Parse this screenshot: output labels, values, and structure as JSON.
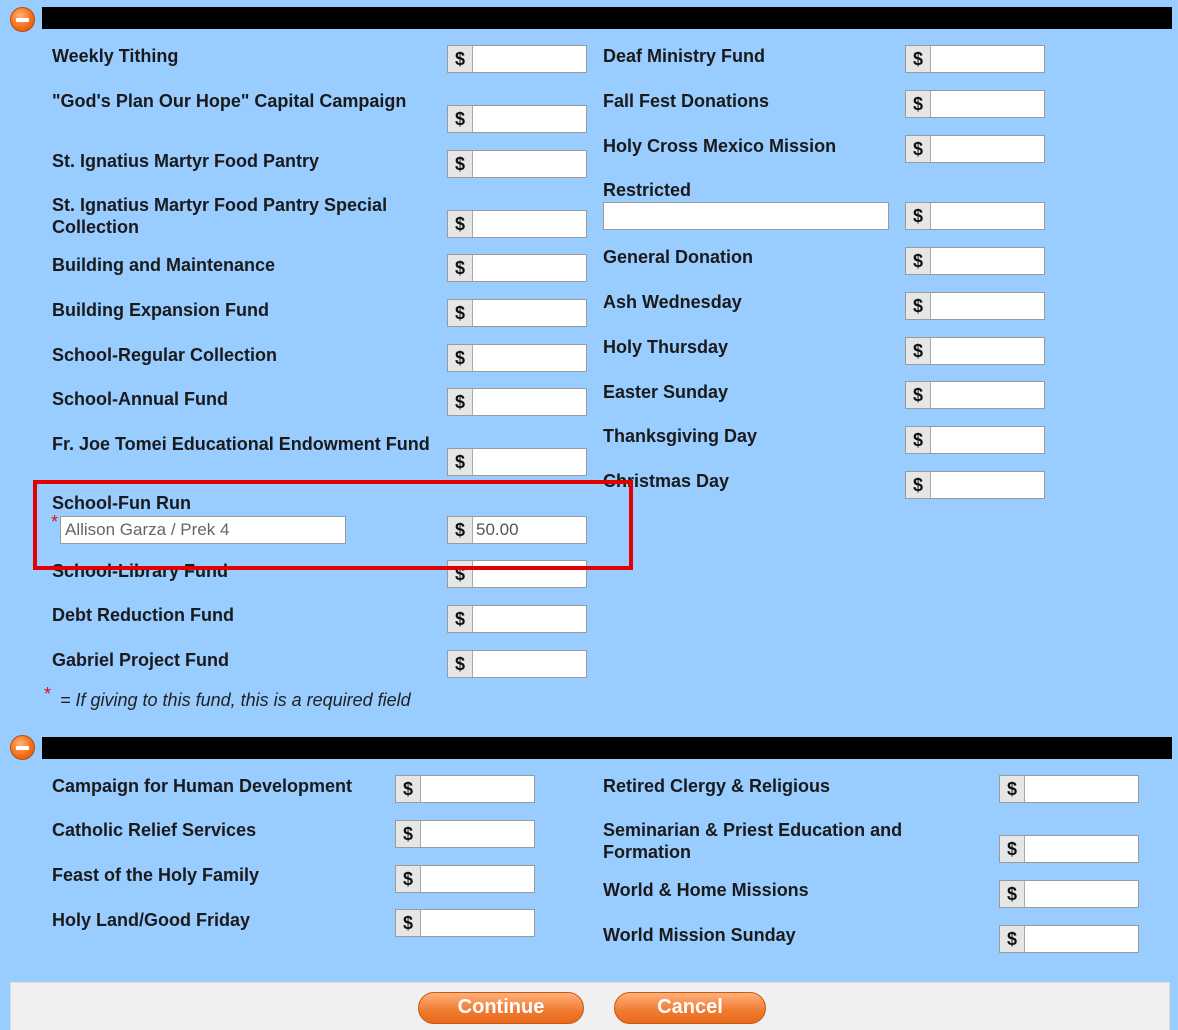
{
  "funds_section": {
    "left": [
      {
        "label": "Weekly Tithing",
        "amount": ""
      },
      {
        "label": "\"God's Plan Our Hope\" Capital Campaign",
        "amount": ""
      },
      {
        "label": "St. Ignatius Martyr Food Pantry",
        "amount": ""
      },
      {
        "label": "St. Ignatius Martyr Food Pantry Special Collection",
        "amount": ""
      },
      {
        "label": "Building and Maintenance",
        "amount": ""
      },
      {
        "label": "Building Expansion Fund",
        "amount": ""
      },
      {
        "label": "School-Regular Collection",
        "amount": ""
      },
      {
        "label": "School-Annual Fund",
        "amount": ""
      },
      {
        "label": "Fr. Joe Tomei Educational Endowment Fund",
        "amount": ""
      },
      {
        "label": "School-Fun Run",
        "note_value": "Allison Garza / Prek 4",
        "amount": "50.00"
      },
      {
        "label": "School-Library Fund",
        "amount": ""
      },
      {
        "label": "Debt Reduction Fund",
        "amount": ""
      },
      {
        "label": "Gabriel Project Fund",
        "amount": ""
      }
    ],
    "right": [
      {
        "label": "Deaf Ministry Fund",
        "amount": ""
      },
      {
        "label": "Fall Fest Donations",
        "amount": ""
      },
      {
        "label": "Holy Cross Mexico Mission",
        "amount": ""
      },
      {
        "label": "Restricted",
        "note_value": "",
        "amount": ""
      },
      {
        "label": "General Donation",
        "amount": ""
      },
      {
        "label": "Ash Wednesday",
        "amount": ""
      },
      {
        "label": "Holy Thursday",
        "amount": ""
      },
      {
        "label": "Easter Sunday",
        "amount": ""
      },
      {
        "label": "Thanksgiving Day",
        "amount": ""
      },
      {
        "label": "Christmas Day",
        "amount": ""
      }
    ],
    "required_note": "= If giving to this fund, this is a required field",
    "required_star": "*",
    "currency_symbol": "$"
  },
  "special_section": {
    "left": [
      {
        "label": "Campaign for Human Development",
        "amount": ""
      },
      {
        "label": "Catholic Relief Services",
        "amount": ""
      },
      {
        "label": "Feast of the Holy Family",
        "amount": ""
      },
      {
        "label": "Holy Land/Good Friday",
        "amount": ""
      }
    ],
    "right": [
      {
        "label": "Retired Clergy & Religious",
        "amount": ""
      },
      {
        "label": "Seminarian & Priest Education and Formation",
        "amount": ""
      },
      {
        "label": "World & Home Missions",
        "amount": ""
      },
      {
        "label": "World Mission Sunday",
        "amount": ""
      }
    ]
  },
  "buttons": {
    "continue": "Continue",
    "cancel": "Cancel"
  },
  "colors": {
    "background": "#99ccff",
    "highlight": "#e00000",
    "button": "#f07a30"
  }
}
